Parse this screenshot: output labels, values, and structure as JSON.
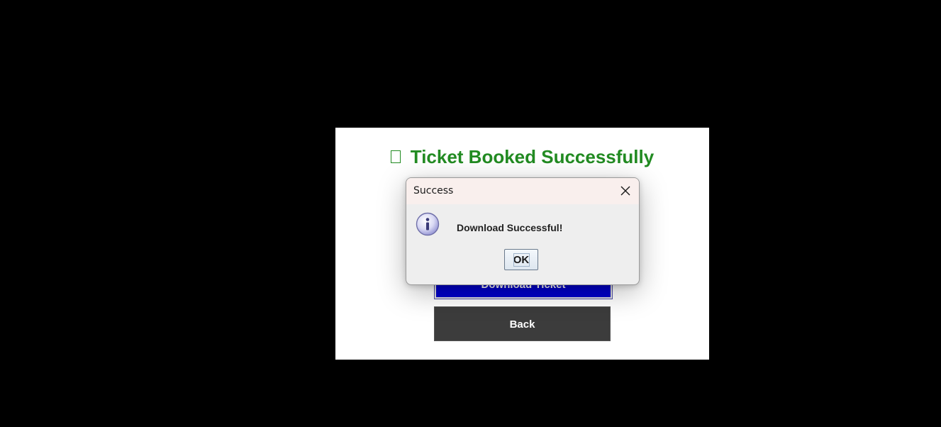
{
  "app": {
    "heading": "Ticket Booked Successfully",
    "heading_icon": "missing-glyph-icon",
    "download_button_label": "Download Ticket",
    "back_button_label": "Back"
  },
  "dialog": {
    "title": "Success",
    "message": "Download Successful!",
    "ok_label": "OK",
    "icon": "info-icon",
    "close_icon": "close-icon"
  },
  "colors": {
    "background": "#000000",
    "heading": "#228b22",
    "download_button": "#0000cc",
    "back_button": "#3c3c3c",
    "dialog_titlebar": "#f9efed"
  }
}
